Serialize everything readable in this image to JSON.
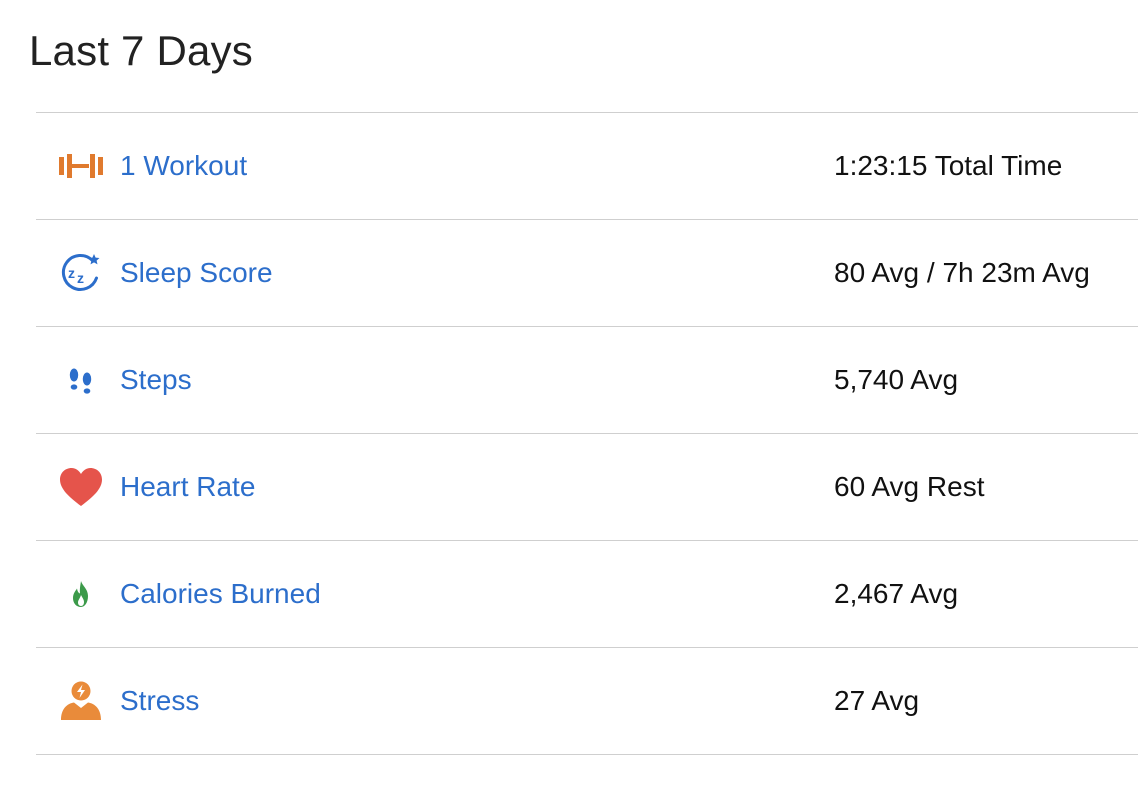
{
  "page": {
    "title": "Last 7 Days"
  },
  "colors": {
    "link": "#2c6ecb",
    "workout_icon": "#e07a2e",
    "sleep_icon": "#2c6ecb",
    "steps_icon": "#2c6ecb",
    "heart_icon": "#e5544b",
    "calories_icon": "#3c9a4a",
    "stress_icon": "#e98b3a",
    "divider": "#cfcfcf"
  },
  "rows": [
    {
      "icon": "dumbbell-icon",
      "label": "1 Workout",
      "value": "1:23:15 Total Time"
    },
    {
      "icon": "sleep-icon",
      "label": "Sleep Score",
      "value": "80 Avg / 7h 23m Avg"
    },
    {
      "icon": "footprints-icon",
      "label": "Steps",
      "value": "5,740 Avg"
    },
    {
      "icon": "heart-icon",
      "label": "Heart Rate",
      "value": "60 Avg Rest"
    },
    {
      "icon": "flame-icon",
      "label": "Calories Burned",
      "value": "2,467 Avg"
    },
    {
      "icon": "stress-person-icon",
      "label": "Stress",
      "value": "27 Avg"
    }
  ]
}
